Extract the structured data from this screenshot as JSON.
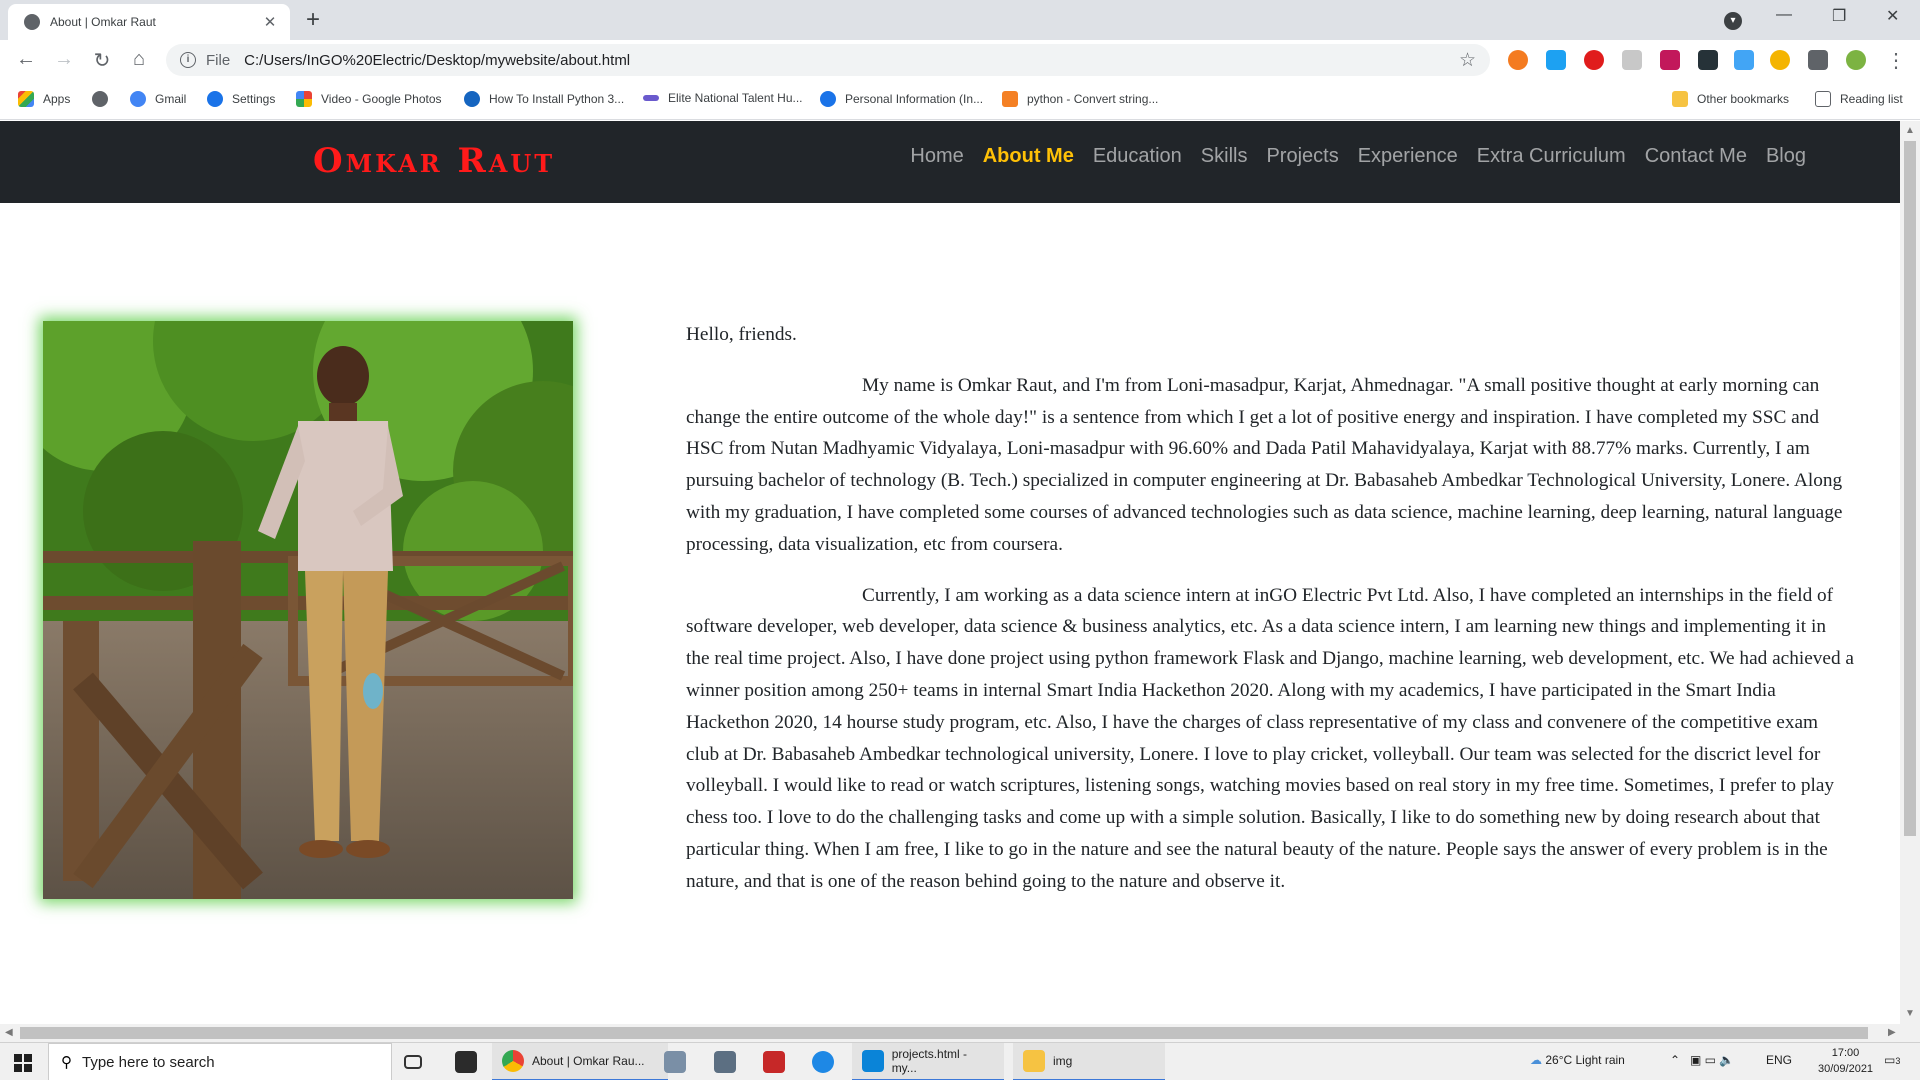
{
  "browser": {
    "tab_title": "About | Omkar Raut",
    "tab_close": "✕",
    "new_tab": "+",
    "url_scheme": "File",
    "url": "C:/Users/InGO%20Electric/Desktop/mywebsite/about.html",
    "window_controls": {
      "minimize": "—",
      "restore": "❐",
      "close": "✕"
    },
    "bookmarks": [
      {
        "label": "Apps",
        "color": "#ea4335"
      },
      {
        "label": "",
        "color": "#5f6368"
      },
      {
        "label": "Gmail",
        "color": "#4285f4"
      },
      {
        "label": "Settings",
        "color": "#1a73e8"
      },
      {
        "label": "Video - Google Photos",
        "color": "#fbbc04"
      },
      {
        "label": "How To Install Python 3...",
        "color": "#1565c0"
      },
      {
        "label": "Elite National Talent Hu...",
        "color": "#6a5acd"
      },
      {
        "label": "Personal Information (In...",
        "color": "#1a73e8"
      },
      {
        "label": "python - Convert string...",
        "color": "#f48024"
      }
    ],
    "other_bookmarks": "Other bookmarks",
    "reading_list": "Reading list"
  },
  "site": {
    "brand": "Omkar Raut",
    "nav": [
      {
        "label": "Home",
        "active": false
      },
      {
        "label": "About Me",
        "active": true
      },
      {
        "label": "Education",
        "active": false
      },
      {
        "label": "Skills",
        "active": false
      },
      {
        "label": "Projects",
        "active": false
      },
      {
        "label": "Experience",
        "active": false
      },
      {
        "label": "Extra Curriculum",
        "active": false
      },
      {
        "label": "Contact Me",
        "active": false
      },
      {
        "label": "Blog",
        "active": false
      }
    ],
    "accent_color": "#ffc107",
    "brand_color": "#ff1a1a"
  },
  "about": {
    "greeting": "Hello, friends.",
    "para1": "My name is Omkar Raut, and I'm from Loni-masadpur, Karjat, Ahmednagar. \"A small positive thought at early morning can change the entire outcome of the whole day!\" is a sentence from which I get a lot of positive energy and inspiration. I have completed my SSC and HSC from Nutan Madhyamic Vidyalaya, Loni-masadpur with 96.60% and Dada Patil Mahavidyalaya, Karjat with 88.77% marks. Currently, I am pursuing bachelor of technology (B. Tech.) specialized in computer engineering at Dr. Babasaheb Ambedkar Technological University, Lonere. Along with my graduation, I have completed some courses of advanced technologies such as data science, machine learning, deep learning, natural language processing, data visualization, etc from coursera.",
    "para2": "Currently, I am working as a data science intern at inGO Electric Pvt Ltd. Also, I have completed an internships in the field of software developer, web developer, data science & business analytics, etc. As a data science intern, I am learning new things and implementing it in the real time project. Also, I have done project using python framework Flask and Django, machine learning, web development, etc. We had achieved a winner position among 250+ teams in internal Smart India Hackethon 2020. Along with my academics, I have participated in the Smart India Hackethon 2020, 14 hourse study program, etc. Also, I have the charges of class representative of my class and convenere of the competitive exam club at Dr. Babasaheb Ambedkar technological university, Lonere. I love to play cricket, volleyball. Our team was selected for the discrict level for volleyball. I would like to read or watch scriptures, listening songs, watching movies based on real story in my free time. Sometimes, I prefer to play chess too. I love to do the challenging tasks and come up with a simple solution. Basically, I like to do something new by doing research about that particular thing. When I am free, I like to go in the nature and see the natural beauty of the nature. People says the answer of every problem is in the nature, and that is one of the reason behind going to the nature and observe it."
  },
  "taskbar": {
    "search_placeholder": "Type here to search",
    "apps": [
      {
        "label": "About | Omkar Rau...",
        "color": "#4285f4"
      },
      {
        "label": "projects.html - my...",
        "color": "#0a84d8"
      },
      {
        "label": "img",
        "color": "#f6c342"
      }
    ],
    "weather": "26°C  Light rain",
    "language": "ENG",
    "time": "17:00",
    "date": "30/09/2021",
    "notifications": "3"
  }
}
